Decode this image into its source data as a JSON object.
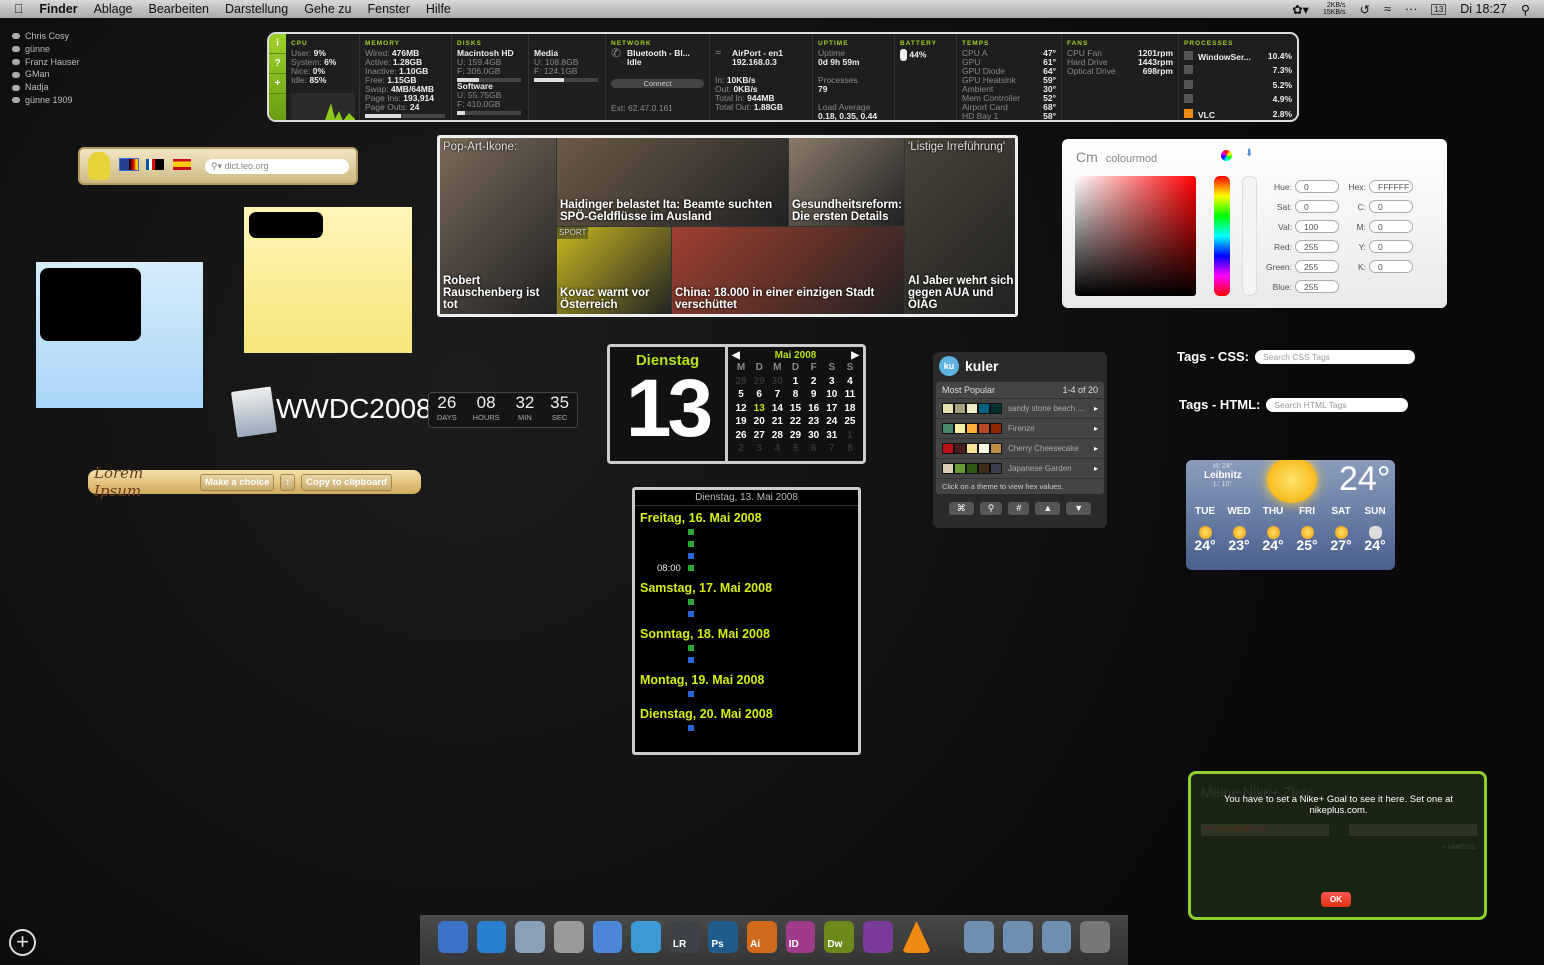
{
  "menubar": {
    "items": [
      "Finder",
      "Ablage",
      "Bearbeiten",
      "Darstellung",
      "Gehe zu",
      "Fenster",
      "Hilfe"
    ],
    "net_up": "2KB/s",
    "net_down": "15KB/s",
    "calendar_day": "13",
    "clock": "Di 18:27"
  },
  "people": [
    "Chris Cosy",
    "günne",
    "Franz Hauser",
    "GMan",
    "Nadja",
    "günne 1909"
  ],
  "istat": {
    "side": [
      "i",
      "?",
      "+"
    ],
    "cpu": {
      "title": "CPU",
      "user": "9%",
      "system": "6%",
      "nice": "0%",
      "idle": "85%"
    },
    "memory": {
      "title": "MEMORY",
      "wired": "476MB",
      "active": "1.28GB",
      "inactive": "1.10GB",
      "free": "1.15GB",
      "swap": "4MB/64MB",
      "page_ins": "193,914",
      "page_outs": "24",
      "used_fraction": 0.45
    },
    "disks": {
      "title": "DISKS",
      "items": [
        {
          "name": "Macintosh HD",
          "u": "159.4GB",
          "f": "306.0GB",
          "used": 0.34
        },
        {
          "name": "Software",
          "u": "55.75GB",
          "f": "410.0GB",
          "used": 0.12
        },
        {
          "name": "Media",
          "u": "108.8GB",
          "f": "124.1GB",
          "used": 0.47
        }
      ]
    },
    "network": {
      "title": "NETWORK",
      "bt": "Bluetooth - Bl...",
      "bt_status": "Idle",
      "connect": "Connect",
      "ext": "Ext: 62.47.0.161",
      "airport": "AirPort - en1",
      "ip": "192.168.0.3",
      "in": "10KB/s",
      "out": "0KB/s",
      "total_in": "944MB",
      "total_out": "1.88GB"
    },
    "uptime": {
      "title": "UPTIME",
      "uptime_label": "Uptime",
      "uptime": "0d 9h 59m",
      "proc_label": "Processes",
      "processes": "79",
      "load_label": "Load Average",
      "load": "0.18, 0.35, 0.44"
    },
    "battery": {
      "title": "BATTERY",
      "level": "44%"
    },
    "temps": {
      "title": "TEMPS",
      "items": [
        [
          "CPU A",
          "47°"
        ],
        [
          "GPU",
          "61°"
        ],
        [
          "GPU Diode",
          "64°"
        ],
        [
          "GPU Heatsink",
          "59°"
        ],
        [
          "Ambient",
          "30°"
        ],
        [
          "Mem Controller",
          "52°"
        ],
        [
          "Airport Card",
          "68°"
        ],
        [
          "HD Bay 1",
          "58°"
        ]
      ]
    },
    "fans": {
      "title": "FANS",
      "items": [
        [
          "CPU Fan",
          "1201rpm"
        ],
        [
          "Hard Drive",
          "1443rpm"
        ],
        [
          "Optical Drive",
          "698rpm"
        ]
      ]
    },
    "processes": {
      "title": "PROCESSES",
      "items": [
        [
          "WindowSer...",
          "10.4%"
        ],
        [
          "",
          "7.3%"
        ],
        [
          "",
          "5.2%"
        ],
        [
          "",
          "4.9%"
        ],
        [
          "VLC",
          "2.8%"
        ]
      ]
    }
  },
  "leo": {
    "placeholder": "dict.leo.org"
  },
  "wwdc": {
    "title": "WWDC2008",
    "units": [
      [
        "26",
        "DAYS"
      ],
      [
        "08",
        "HOURS"
      ],
      [
        "32",
        "MIN"
      ],
      [
        "35",
        "SEC"
      ]
    ]
  },
  "lorem": {
    "logo": "Lorem Ipsum",
    "choice": "Make a choice",
    "copy": "Copy to clipboard"
  },
  "news": {
    "tiles": [
      {
        "top": "Pop-Art-Ikone:",
        "cap": "Robert Rauschenberg ist tot"
      },
      {
        "top": "",
        "cap": "Haidinger belastet Ita: Beamte suchten SPÖ-Geldflüsse im Ausland"
      },
      {
        "top": "",
        "cap": "Gesundheitsreform: Die ersten Details"
      },
      {
        "top": "'Listige Irreführung'",
        "cap": "Al Jaber wehrt sich gegen AUA und ÖIAG"
      },
      {
        "top": "SPORT",
        "cap": "Kovac warnt vor Österreich"
      },
      {
        "top": "",
        "cap": "China: 18.000 in einer einzigen Stadt verschüttet"
      }
    ]
  },
  "calendar": {
    "weekday": "Dienstag",
    "day": "13",
    "month": "Mai 2008",
    "headers": [
      "M",
      "D",
      "M",
      "D",
      "F",
      "S",
      "S"
    ],
    "weeks": [
      [
        "28",
        "29",
        "30",
        "1",
        "2",
        "3",
        "4"
      ],
      [
        "5",
        "6",
        "7",
        "8",
        "9",
        "10",
        "11"
      ],
      [
        "12",
        "13",
        "14",
        "15",
        "16",
        "17",
        "18"
      ],
      [
        "19",
        "20",
        "21",
        "22",
        "23",
        "24",
        "25"
      ],
      [
        "26",
        "27",
        "28",
        "29",
        "30",
        "31",
        "1"
      ],
      [
        "2",
        "3",
        "4",
        "5",
        "6",
        "7",
        "8"
      ]
    ]
  },
  "events": {
    "header": "Dienstag, 13. Mai 2008",
    "days": [
      {
        "title": "Freitag, 16. Mai 2008",
        "marks": [
          "green",
          "green",
          "blue",
          "green"
        ],
        "time": "08:00"
      },
      {
        "title": "Samstag, 17. Mai 2008",
        "marks": [
          "green",
          "blue"
        ]
      },
      {
        "title": "Sonntag, 18. Mai 2008",
        "marks": [
          "green",
          "blue"
        ]
      },
      {
        "title": "Montag, 19. Mai 2008",
        "marks": [
          "blue"
        ]
      },
      {
        "title": "Dienstag, 20. Mai 2008",
        "marks": [
          "blue"
        ]
      }
    ]
  },
  "kuler": {
    "logo": "ku",
    "title": "kuler",
    "section": "Most Popular",
    "range": "1-4 of 20",
    "footer": "Click on a theme to view hex values.",
    "themes": [
      {
        "name": "sandy stone beach ...",
        "colors": [
          "#e6e2af",
          "#a7a37e",
          "#efecca",
          "#046380",
          "#002f2f"
        ]
      },
      {
        "name": "Firenze",
        "colors": [
          "#468966",
          "#fff0a5",
          "#ffb03b",
          "#b64926",
          "#8e2800"
        ]
      },
      {
        "name": "Cherry Cheesecake",
        "colors": [
          "#b9121b",
          "#4c1b1b",
          "#f6e497",
          "#fcfae1",
          "#bd8d46"
        ]
      },
      {
        "name": "Japanese Garden",
        "colors": [
          "#d9ceb2",
          "#6b9b37",
          "#2f5a15",
          "#3f2b19",
          "#3a3e4a"
        ]
      }
    ],
    "buttons": [
      "rss",
      "search",
      "#",
      "up",
      "down"
    ]
  },
  "colourmod": {
    "title": "colourmod",
    "fields_left": [
      [
        "Hue:",
        "0"
      ],
      [
        "Sat:",
        "0"
      ],
      [
        "Val:",
        "100"
      ],
      [
        "Red:",
        "255"
      ],
      [
        "Green:",
        "255"
      ],
      [
        "Blue:",
        "255"
      ]
    ],
    "fields_right": [
      [
        "Hex:",
        "FFFFFF"
      ],
      [
        "C:",
        "0"
      ],
      [
        "M:",
        "0"
      ],
      [
        "Y:",
        "0"
      ],
      [
        "K:",
        "0"
      ]
    ]
  },
  "tags": {
    "css_label": "Tags - CSS:",
    "css_placeholder": "Search CSS Tags",
    "html_label": "Tags - HTML:",
    "html_placeholder": "Search HTML Tags"
  },
  "weather": {
    "city": "Leibnitz",
    "high": "H: 24°",
    "low": "L: 10°",
    "temp": "24°",
    "forecast": [
      [
        "TUE",
        "24°"
      ],
      [
        "WED",
        "23°"
      ],
      [
        "THU",
        "24°"
      ],
      [
        "FRI",
        "25°"
      ],
      [
        "SAT",
        "27°"
      ],
      [
        "SUN",
        "24°"
      ]
    ]
  },
  "nike": {
    "message": "You have to set a Nike+ Goal to see it here. Set one at nikeplus.com.",
    "bg_title": "Meine Nike+ Ziele",
    "email": "mr.clean@gmx.at",
    "logout": "» ABMELDE",
    "ok": "OK"
  },
  "dock": [
    {
      "name": "finder",
      "label": "",
      "color": "#3b73c8"
    },
    {
      "name": "safari",
      "label": "",
      "color": "#2a7fd0"
    },
    {
      "name": "mail",
      "label": "",
      "color": "#8aa0b8"
    },
    {
      "name": "newspaper",
      "label": "",
      "color": "#9a9a9a"
    },
    {
      "name": "ichat",
      "label": "",
      "color": "#4c86d8"
    },
    {
      "name": "itunes",
      "label": "",
      "color": "#3c9ad6"
    },
    {
      "name": "lightroom",
      "label": "LR",
      "color": "#3d4248"
    },
    {
      "name": "photoshop",
      "label": "Ps",
      "color": "#1f5c8c"
    },
    {
      "name": "illustrator",
      "label": "Ai",
      "color": "#d06b1d"
    },
    {
      "name": "indesign",
      "label": "ID",
      "color": "#a03a8a"
    },
    {
      "name": "dreamweaver",
      "label": "Dw",
      "color": "#6b8a1a"
    },
    {
      "name": "globe-app",
      "label": "",
      "color": "#7a3a9a"
    },
    {
      "name": "vlc",
      "label": "",
      "color": "#f08a10"
    },
    {
      "name": "folder-documents",
      "label": "",
      "color": "#6e8fb0"
    },
    {
      "name": "folder-library",
      "label": "",
      "color": "#6e8fb0"
    },
    {
      "name": "folder-applications",
      "label": "",
      "color": "#6e8fb0"
    },
    {
      "name": "trash",
      "label": "",
      "color": "#777"
    }
  ]
}
